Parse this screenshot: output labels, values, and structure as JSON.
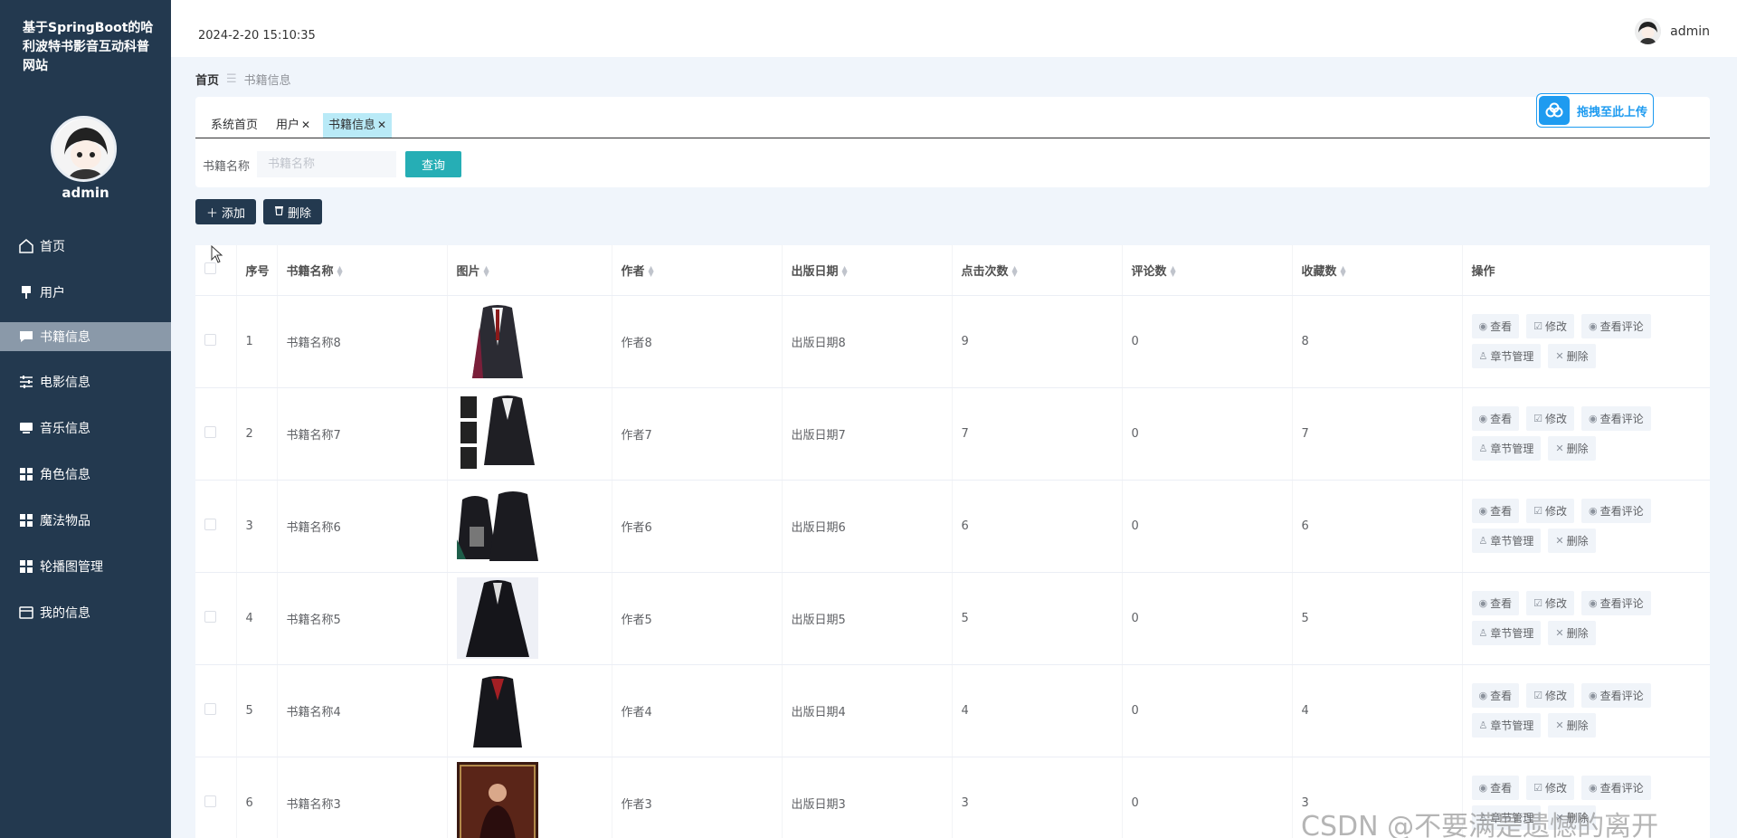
{
  "sidebar": {
    "title": "基于SpringBoot的哈利波特书影音互动科普网站",
    "username": "admin",
    "items": [
      {
        "label": "首页",
        "icon": "home-icon"
      },
      {
        "label": "用户",
        "icon": "pin-icon"
      },
      {
        "label": "书籍信息",
        "icon": "chat-icon",
        "active": true
      },
      {
        "label": "电影信息",
        "icon": "sliders-icon"
      },
      {
        "label": "音乐信息",
        "icon": "monitor-icon"
      },
      {
        "label": "角色信息",
        "icon": "grid-icon"
      },
      {
        "label": "魔法物品",
        "icon": "grid-icon"
      },
      {
        "label": "轮播图管理",
        "icon": "grid-icon"
      },
      {
        "label": "我的信息",
        "icon": "card-icon"
      }
    ]
  },
  "header": {
    "datetime": "2024-2-20 15:10:35",
    "username": "admin"
  },
  "breadcrumb": {
    "home": "首页",
    "current": "书籍信息"
  },
  "upload": {
    "label": "拖拽至此上传"
  },
  "tabs": [
    {
      "label": "系统首页",
      "closable": false
    },
    {
      "label": "用户",
      "closable": true
    },
    {
      "label": "书籍信息",
      "closable": true,
      "active": true
    }
  ],
  "search": {
    "label": "书籍名称",
    "placeholder": "书籍名称",
    "button": "查询"
  },
  "actions": {
    "add": "添加",
    "delete": "删除"
  },
  "table": {
    "columns": [
      "序号",
      "书籍名称",
      "图片",
      "作者",
      "出版日期",
      "点击次数",
      "评论数",
      "收藏数",
      "操作"
    ],
    "ops": {
      "view": "查看",
      "edit": "修改",
      "view_comments": "查看评论",
      "chapters": "章节管理",
      "delete": "删除"
    },
    "rows": [
      {
        "index": "1",
        "name": "书籍名称8",
        "author": "作者8",
        "date": "出版日期8",
        "clicks": "9",
        "comments": "0",
        "favorites": "8"
      },
      {
        "index": "2",
        "name": "书籍名称7",
        "author": "作者7",
        "date": "出版日期7",
        "clicks": "7",
        "comments": "0",
        "favorites": "7"
      },
      {
        "index": "3",
        "name": "书籍名称6",
        "author": "作者6",
        "date": "出版日期6",
        "clicks": "6",
        "comments": "0",
        "favorites": "6"
      },
      {
        "index": "4",
        "name": "书籍名称5",
        "author": "作者5",
        "date": "出版日期5",
        "clicks": "5",
        "comments": "0",
        "favorites": "5"
      },
      {
        "index": "5",
        "name": "书籍名称4",
        "author": "作者4",
        "date": "出版日期4",
        "clicks": "4",
        "comments": "0",
        "favorites": "4"
      },
      {
        "index": "6",
        "name": "书籍名称3",
        "author": "作者3",
        "date": "出版日期3",
        "clicks": "3",
        "comments": "0",
        "favorites": "3"
      }
    ]
  },
  "watermark": "CSDN @不要满是遗憾的离开"
}
